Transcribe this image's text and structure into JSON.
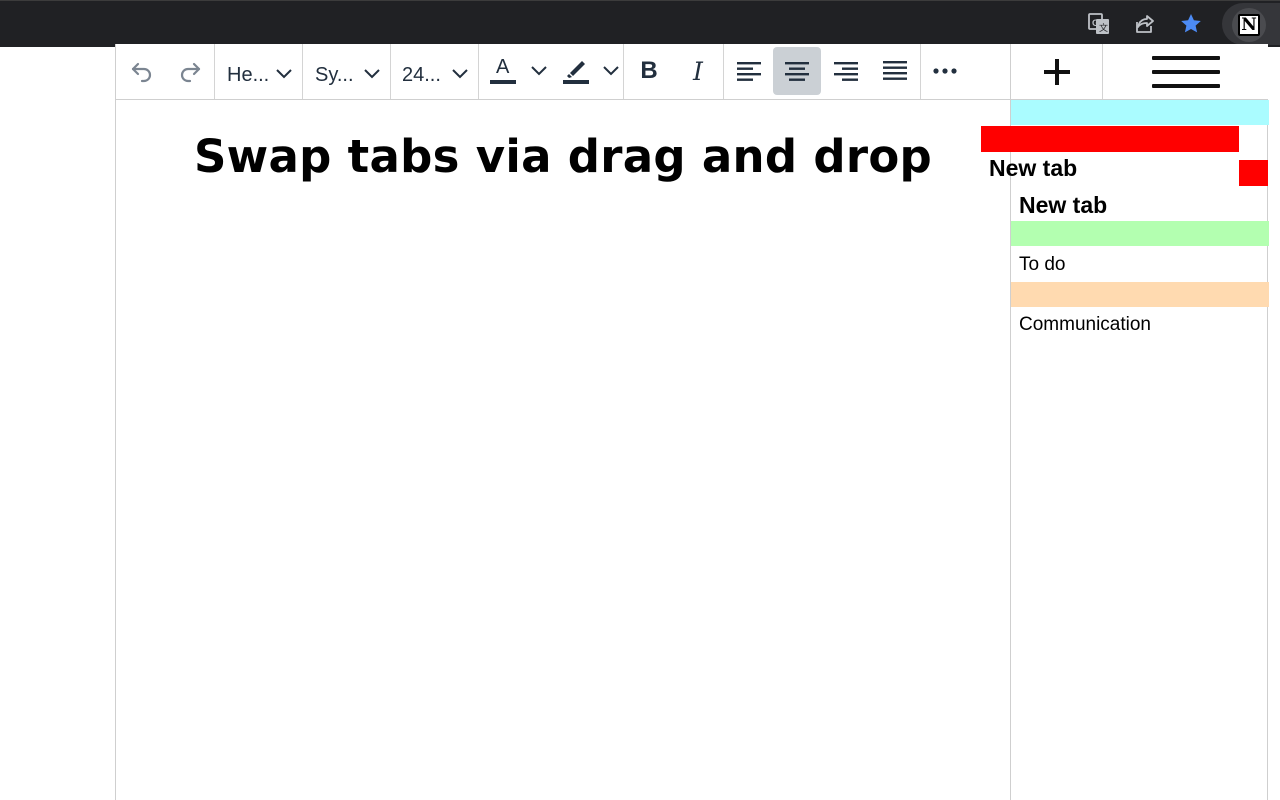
{
  "browser": {
    "icons": [
      "translate-icon",
      "share-icon",
      "bookmark-star-icon",
      "notion-icon"
    ],
    "star_color": "#4c8bf5",
    "extension_letter": "N"
  },
  "toolbar": {
    "undo_icon": "undo-icon",
    "redo_icon": "redo-icon",
    "block_format_label": "He...",
    "font_family_label": "Sy...",
    "font_size_label": "24...",
    "text_color_letter": "A",
    "bold_label": "B",
    "italic_label": "I",
    "more_icon": "more-icon",
    "active_alignment": "center"
  },
  "side_header": {
    "add_tab_icon": "plus-icon",
    "menu_icon": "hamburger-menu-icon"
  },
  "document": {
    "title": "Swap tabs via drag and drop"
  },
  "sidebar": {
    "tabs": [
      {
        "label": "",
        "color": "#aafcff"
      },
      {
        "label": "New tab",
        "color": "#ffffff"
      },
      {
        "label": "To do",
        "color": "#b3ffb0"
      },
      {
        "label": "Communication",
        "color": "#ffdab0"
      }
    ],
    "drag_ghost": {
      "label": "New tab",
      "color": "#ff0000"
    }
  }
}
